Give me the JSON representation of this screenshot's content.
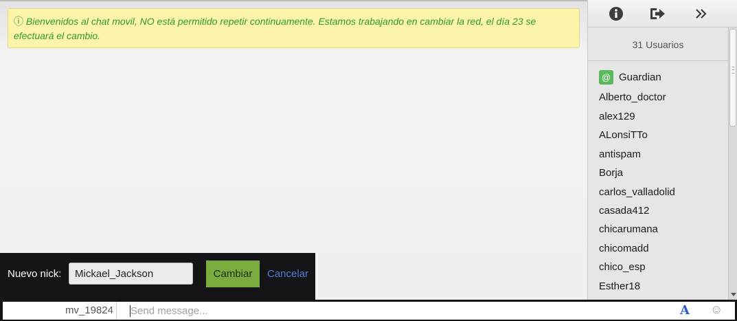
{
  "notice": {
    "icon": "info-circle-icon",
    "icon_glyph": "ⓘ",
    "text": "Bienvenidos al chat movil, NO está permitido repetir continuamente. Estamos trabajando en cambiar la red, el día 23 se efectuará el cambio."
  },
  "nick_change": {
    "label": "Nuevo nick:",
    "value": "Mickael_Jackson",
    "submit_label": "Cambiar",
    "cancel_label": "Cancelar"
  },
  "sidebar": {
    "toolbar": {
      "info": "info-icon",
      "logout": "logout-icon",
      "collapse": "double-chevron-right-icon"
    },
    "user_count": "31 Usuarios",
    "users": [
      {
        "name": "Guardian",
        "badge": "@"
      },
      {
        "name": "Alberto_doctor"
      },
      {
        "name": "alex129"
      },
      {
        "name": "ALonsiTTo"
      },
      {
        "name": "antispam"
      },
      {
        "name": "Borja"
      },
      {
        "name": "carlos_valladolid"
      },
      {
        "name": "casada412"
      },
      {
        "name": "chicarumana"
      },
      {
        "name": "chicomadd"
      },
      {
        "name": "chico_esp"
      },
      {
        "name": "Esther18"
      }
    ]
  },
  "bottom": {
    "self_nick": "mv_19824",
    "placeholder": "Send message...",
    "font_icon_glyph": "A",
    "emoji_icon_glyph": "☺"
  },
  "colors": {
    "notice_bg": "#fcf4a8",
    "notice_text": "#2e9a2e",
    "cambiar_bg": "#79ab3d",
    "link": "#4d7fd6",
    "moderator_badge": "#5cb85c",
    "dark_bar": "#141416"
  }
}
